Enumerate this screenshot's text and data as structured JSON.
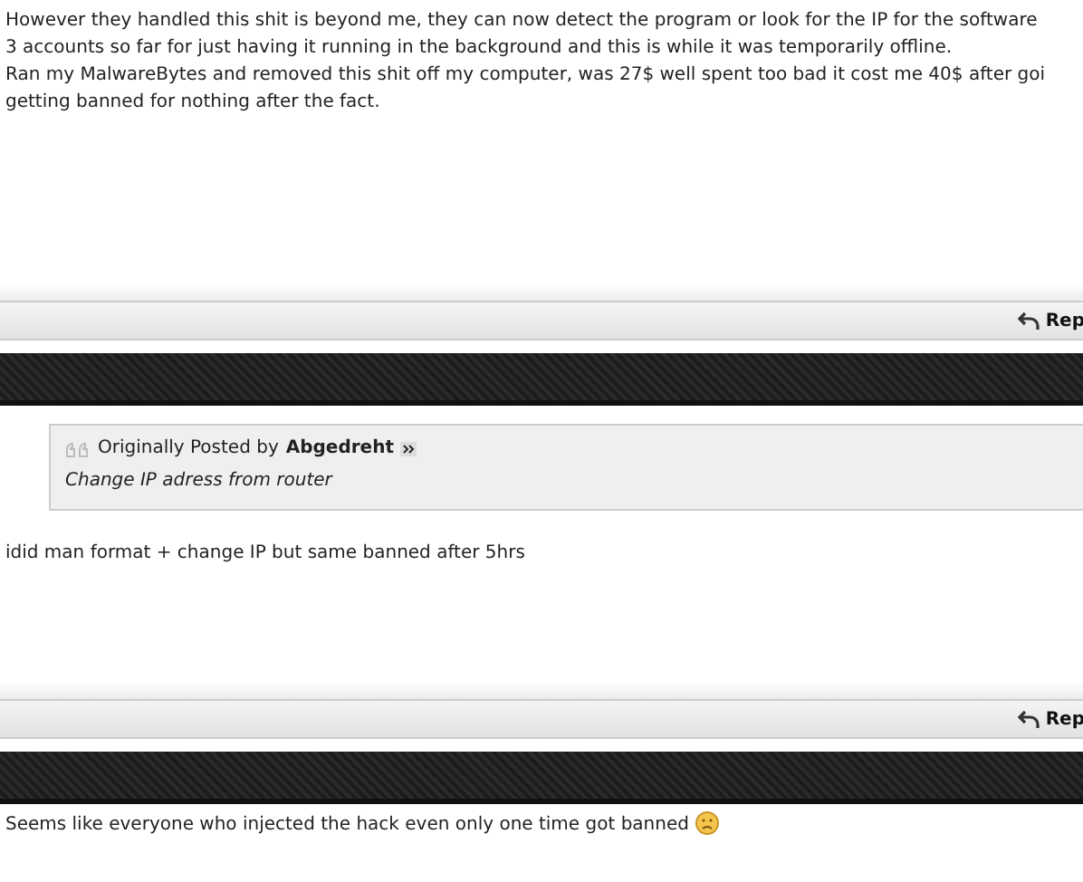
{
  "posts": [
    {
      "lines": [
        "However they handled this shit is beyond me, they can now detect the program or look for the IP for the software",
        "3 accounts so far for just having it running in the background and this is while it was temporarily offline.",
        "Ran my MalwareBytes and removed this shit off my computer, was 27$ well spent too bad it cost me 40$ after goi",
        "getting banned for nothing after the fact."
      ],
      "reply": "Rep"
    },
    {
      "quote": {
        "prefix": "Originally Posted by",
        "author": "Abgedreht",
        "text": "Change IP adress from router"
      },
      "lines": [
        "idid man format + change IP but same banned after 5hrs"
      ],
      "reply": "Rep"
    },
    {
      "lines": [
        "Seems like everyone who injected the hack even only one time got banned"
      ],
      "smiley": true
    }
  ]
}
